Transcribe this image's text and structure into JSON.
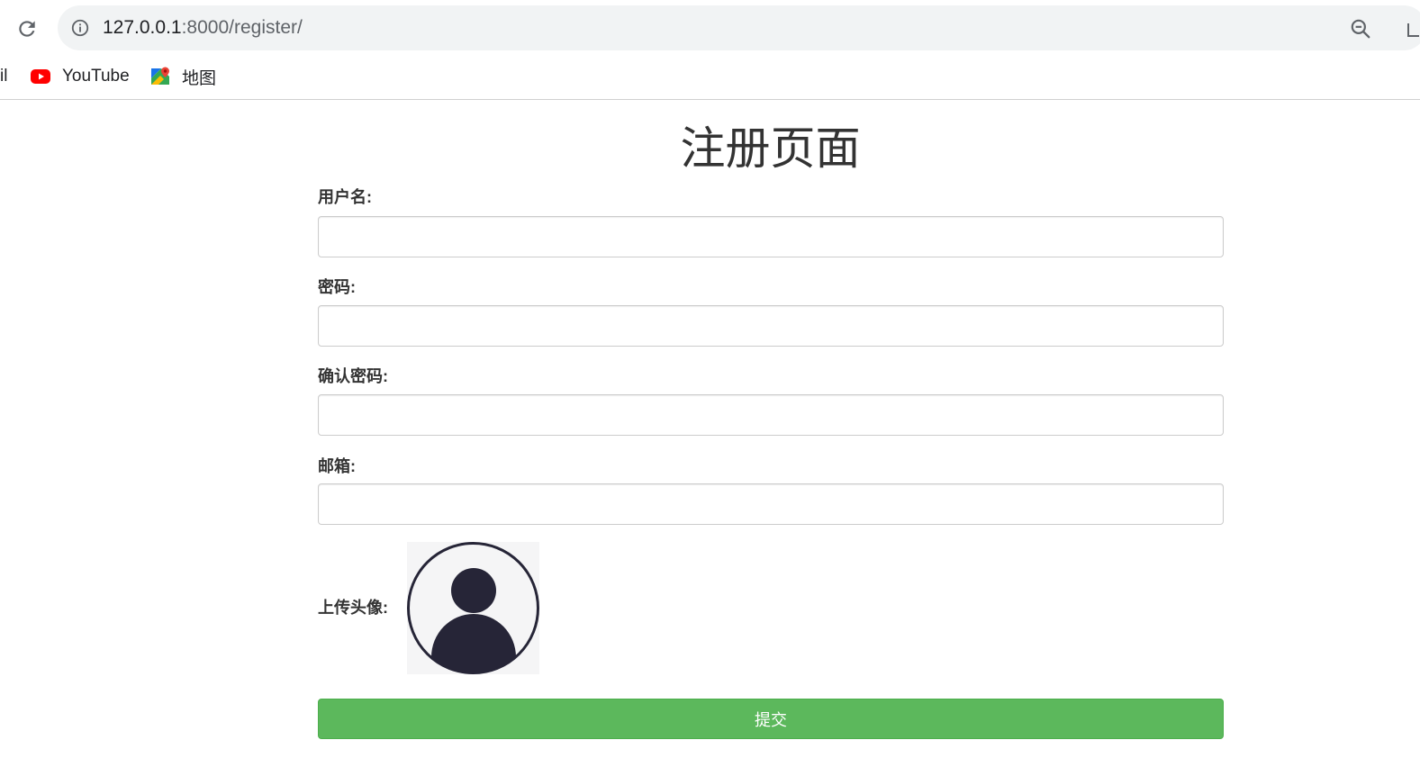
{
  "browser": {
    "url_host": "127.0.0.1",
    "url_rest": ":8000/register/",
    "bookmarks": {
      "partial": "il",
      "youtube": "YouTube",
      "maps": "地图"
    }
  },
  "form": {
    "title": "注册页面",
    "username_label": "用户名:",
    "password_label": "密码:",
    "confirm_label": "确认密码:",
    "email_label": "邮箱:",
    "avatar_label": "上传头像:",
    "submit_label": "提交"
  },
  "colors": {
    "submit_bg": "#5cb85c",
    "avatar_fg": "#262537",
    "youtube_red": "#ff0000"
  },
  "icons": {
    "reload": "reload-icon",
    "info": "info-icon",
    "zoom": "zoom-out-icon",
    "youtube": "youtube-icon",
    "maps": "maps-icon",
    "avatar": "avatar-placeholder-icon"
  }
}
